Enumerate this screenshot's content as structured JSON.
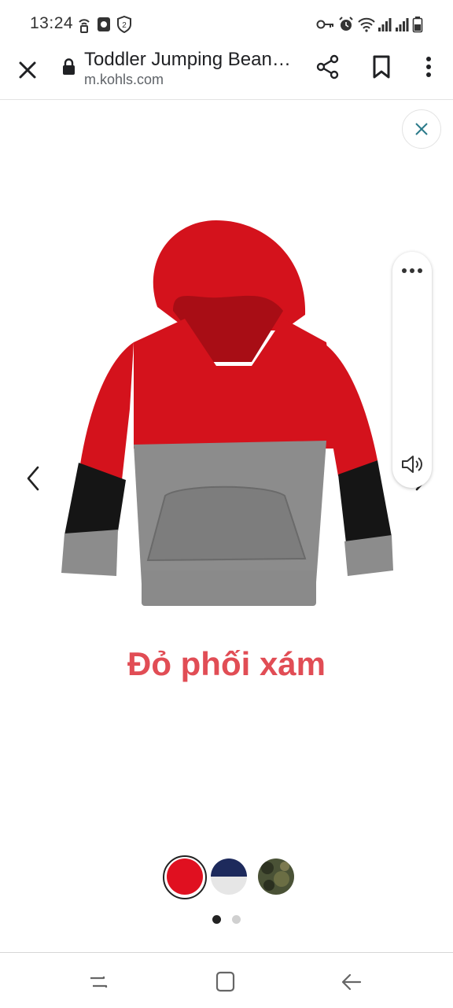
{
  "status_bar": {
    "time": "13:24",
    "icons": [
      "hotspot-icon",
      "app-notification-icon",
      "badge-2-icon",
      "key-icon",
      "alarm-icon",
      "wifi-icon",
      "signal-icon",
      "signal-icon",
      "battery-icon"
    ],
    "badge_number": "2"
  },
  "toolbar": {
    "page_title": "Toddler Jumping Bean…",
    "url": "m.kohls.com",
    "icons": [
      "close-icon",
      "lock-icon",
      "share-icon",
      "bookmark-icon",
      "more-vert-icon"
    ]
  },
  "product": {
    "caption": "Đỏ phối xám",
    "colors": {
      "red": "#d4121c",
      "gray": "#8c8c8c",
      "black": "#151515",
      "caption": "#e14d55"
    },
    "swatches": [
      {
        "name": "red",
        "color": "#e01020",
        "selected": true
      },
      {
        "name": "navy-white",
        "color": "#1d2a5c",
        "selected": false
      },
      {
        "name": "camo",
        "color": "#4a5236",
        "selected": false
      }
    ],
    "pager": {
      "count": 2,
      "active": 1
    }
  },
  "side_panel": {
    "icons": [
      "more-horizontal-icon",
      "speaker-icon"
    ]
  },
  "nav_bar": {
    "icons": [
      "recent-apps-icon",
      "home-icon",
      "back-icon"
    ]
  }
}
